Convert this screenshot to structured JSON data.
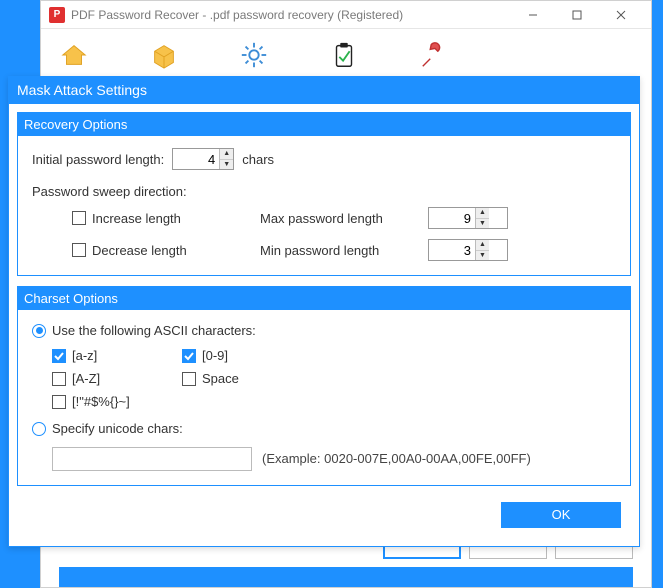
{
  "parent": {
    "title": "PDF Password Recover - .pdf password recovery (Registered)",
    "app_icon_letter": "P"
  },
  "dialog": {
    "title": "Mask Attack Settings",
    "ok_label": "OK"
  },
  "recovery": {
    "panel_title": "Recovery Options",
    "initial_label": "Initial password length:",
    "initial_value": "4",
    "chars_suffix": "chars",
    "sweep_label": "Password sweep direction:",
    "increase_label": "Increase length",
    "decrease_label": "Decrease length",
    "max_label": "Max password length",
    "max_value": "9",
    "min_label": "Min password length",
    "min_value": "3",
    "increase_checked": false,
    "decrease_checked": false
  },
  "charset": {
    "panel_title": "Charset Options",
    "ascii_radio_label": "Use the following ASCII characters:",
    "ascii_selected": true,
    "opts": {
      "az": {
        "label": "[a-z]",
        "checked": true
      },
      "d09": {
        "label": "[0-9]",
        "checked": true
      },
      "AZ": {
        "label": "[A-Z]",
        "checked": false
      },
      "space": {
        "label": "Space",
        "checked": false
      },
      "sym": {
        "label": "[!\"#$%{}~]",
        "checked": false
      }
    },
    "unicode_radio_label": "Specify unicode chars:",
    "unicode_selected": false,
    "unicode_value": "",
    "example": "(Example: 0020-007E,00A0-00AA,00FE,00FF)"
  }
}
